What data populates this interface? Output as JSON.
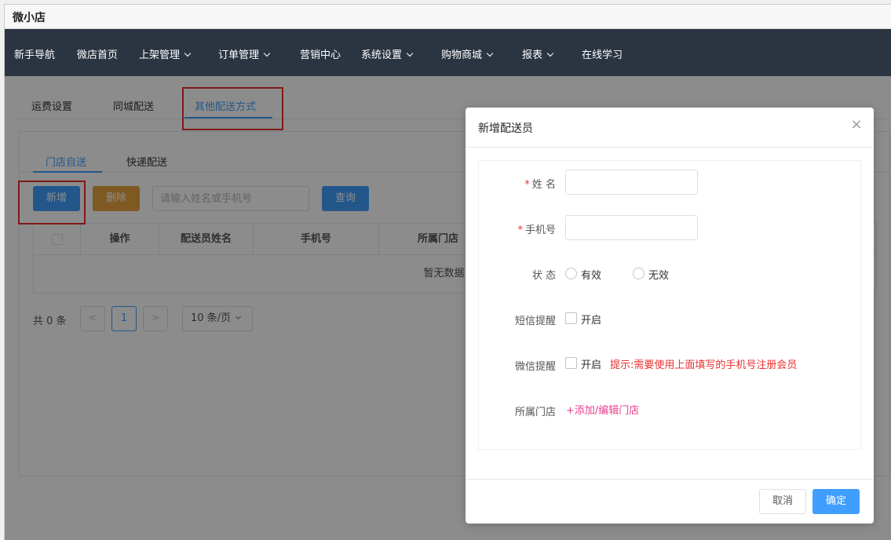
{
  "window": {
    "title": "微小店"
  },
  "nav": {
    "items": [
      {
        "label": "新手导航"
      },
      {
        "label": "微店首页"
      },
      {
        "label": "上架管理"
      },
      {
        "label": "订单管理"
      },
      {
        "label": "营销中心"
      },
      {
        "label": "系统设置"
      },
      {
        "label": "购物商城"
      },
      {
        "label": "报表"
      },
      {
        "label": "在线学习"
      }
    ]
  },
  "tabs_top": [
    {
      "label": "运费设置"
    },
    {
      "label": "同城配送"
    },
    {
      "label": "其他配送方式",
      "active": true
    }
  ],
  "tabs_sub": [
    {
      "label": "门店自送",
      "active": true
    },
    {
      "label": "快递配送"
    }
  ],
  "toolbar": {
    "add_label": "新增",
    "delete_label": "删除",
    "search_placeholder": "请输入姓名或手机号",
    "query_label": "查询"
  },
  "table": {
    "columns": [
      "操作",
      "配送员姓名",
      "手机号",
      "所属门店"
    ],
    "empty_text": "暂无数据"
  },
  "pagination": {
    "total_text": "共 0 条",
    "prev": "<",
    "current_page": "1",
    "next": ">",
    "page_size": "10 条/页"
  },
  "modal": {
    "title": "新增配送员",
    "close": "×",
    "fields": {
      "name_label": "姓 名",
      "phone_label": "手机号",
      "status_label": "状 态",
      "status_valid": "有效",
      "status_invalid": "无效",
      "sms_label": "短信提醒",
      "sms_option": "开启",
      "wechat_label": "微信提醒",
      "wechat_option": "开启",
      "wechat_hint": "提示:需要使用上面填写的手机号注册会员",
      "store_label": "所属门店",
      "store_link": "+添加/编辑门店"
    },
    "cancel_label": "取消",
    "ok_label": "确定"
  },
  "colors": {
    "primary": "#409eff",
    "warning": "#e6a23c",
    "danger": "#e8312f",
    "nav_bg": "#2b3441",
    "link_pink": "#e83e8c"
  }
}
